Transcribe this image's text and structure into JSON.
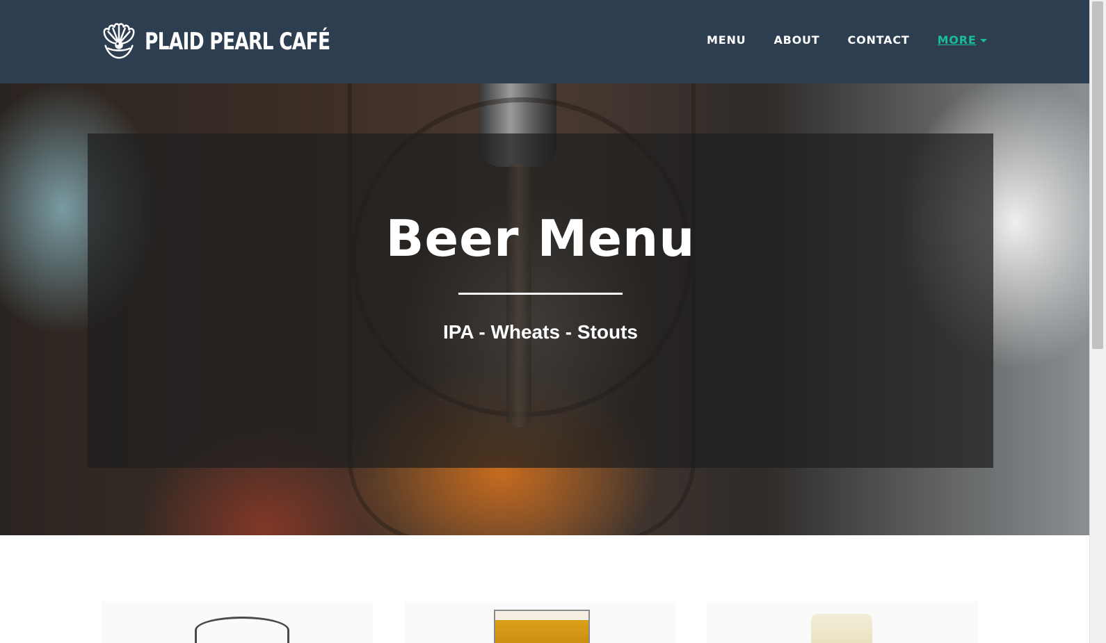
{
  "navbar": {
    "brand_name": "PLAID PEARL CAFÉ",
    "logo_icon": "shell-pearl-icon",
    "links": [
      {
        "label": "MENU"
      },
      {
        "label": "ABOUT"
      },
      {
        "label": "CONTACT"
      },
      {
        "label": "MORE"
      }
    ]
  },
  "hero": {
    "title": "Beer Menu",
    "subtitle": "IPA - Wheats - Stouts"
  },
  "colors": {
    "navbar_bg": "#2c3e50",
    "accent": "#1abc9c",
    "text_light": "#ffffff"
  }
}
